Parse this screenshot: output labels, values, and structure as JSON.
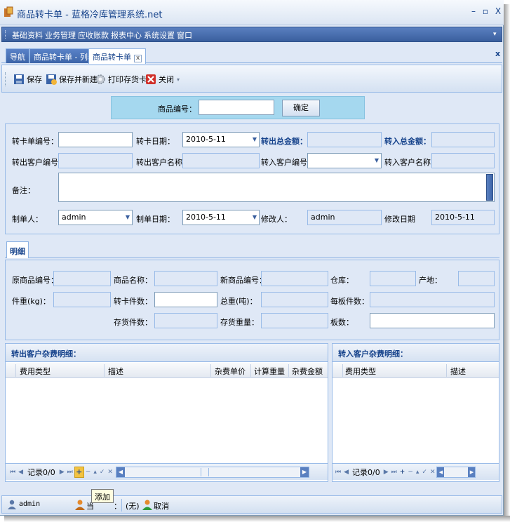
{
  "window": {
    "title": "商品转卡单 - 蓝格冷库管理系统.net",
    "minimize": "–",
    "restore": "▫",
    "close": "X"
  },
  "menu": [
    "基础资料",
    "业务管理",
    "应收账款",
    "报表中心",
    "系统设置",
    "窗口"
  ],
  "tabs": [
    {
      "label": "导航"
    },
    {
      "label": "商品转卡单 - 列表"
    },
    {
      "label": "商品转卡单",
      "close": "x"
    }
  ],
  "tabs_close_all": "x",
  "toolbar": {
    "save": "保存",
    "save_new": "保存并新建",
    "print": "打印存货卡",
    "close": "关闭"
  },
  "search": {
    "label": "商品编号：",
    "confirm": "确定",
    "value": ""
  },
  "header": {
    "card_no_label": "转卡单编号：",
    "card_date_label": "转卡日期：",
    "card_date_value": "2010-5-11",
    "out_total_label": "转出总金额：",
    "in_total_label": "转入总金额：",
    "out_cust_no_label": "转出客户编号：",
    "out_cust_name_label": "转出客户名称：",
    "in_cust_no_label": "转入客户编号：",
    "in_cust_name_label": "转入客户名称：",
    "remark_label": "备注：",
    "creator_label": "制单人：",
    "creator_value": "admin",
    "create_date_label": "制单日期：",
    "create_date_value": "2010-5-11",
    "modifier_label": "修改人：",
    "modifier_value": "admin",
    "modify_date_label": "修改日期",
    "modify_date_value": "2010-5-11"
  },
  "detail": {
    "tab_label": "明细",
    "orig_no_label": "原商品编号：",
    "name_label": "商品名称：",
    "new_no_label": "新商品编号：",
    "warehouse_label": "仓库：",
    "origin_label": "产地：",
    "weight_label": "件重(kg)：",
    "count_label": "转卡件数：",
    "total_weight_label": "总重(吨)：",
    "per_board_label": "每板件数：",
    "stock_count_label": "存货件数：",
    "stock_weight_label": "存货重量：",
    "boards_label": "板数："
  },
  "out_fees": {
    "title": "转出客户杂费明细：",
    "columns": [
      "费用类型",
      "描述",
      "杂费单价",
      "计算重量",
      "杂费金额"
    ],
    "pager_text": "记录0/0"
  },
  "in_fees": {
    "title": "转入客户杂费明细：",
    "columns": [
      "费用类型",
      "描述"
    ],
    "pager_text": "记录0/0"
  },
  "tooltip": "添加",
  "status": {
    "user": "admin",
    "current_label": "当",
    "current_suffix": "：",
    "none": "(无)",
    "cancel": "取消"
  }
}
